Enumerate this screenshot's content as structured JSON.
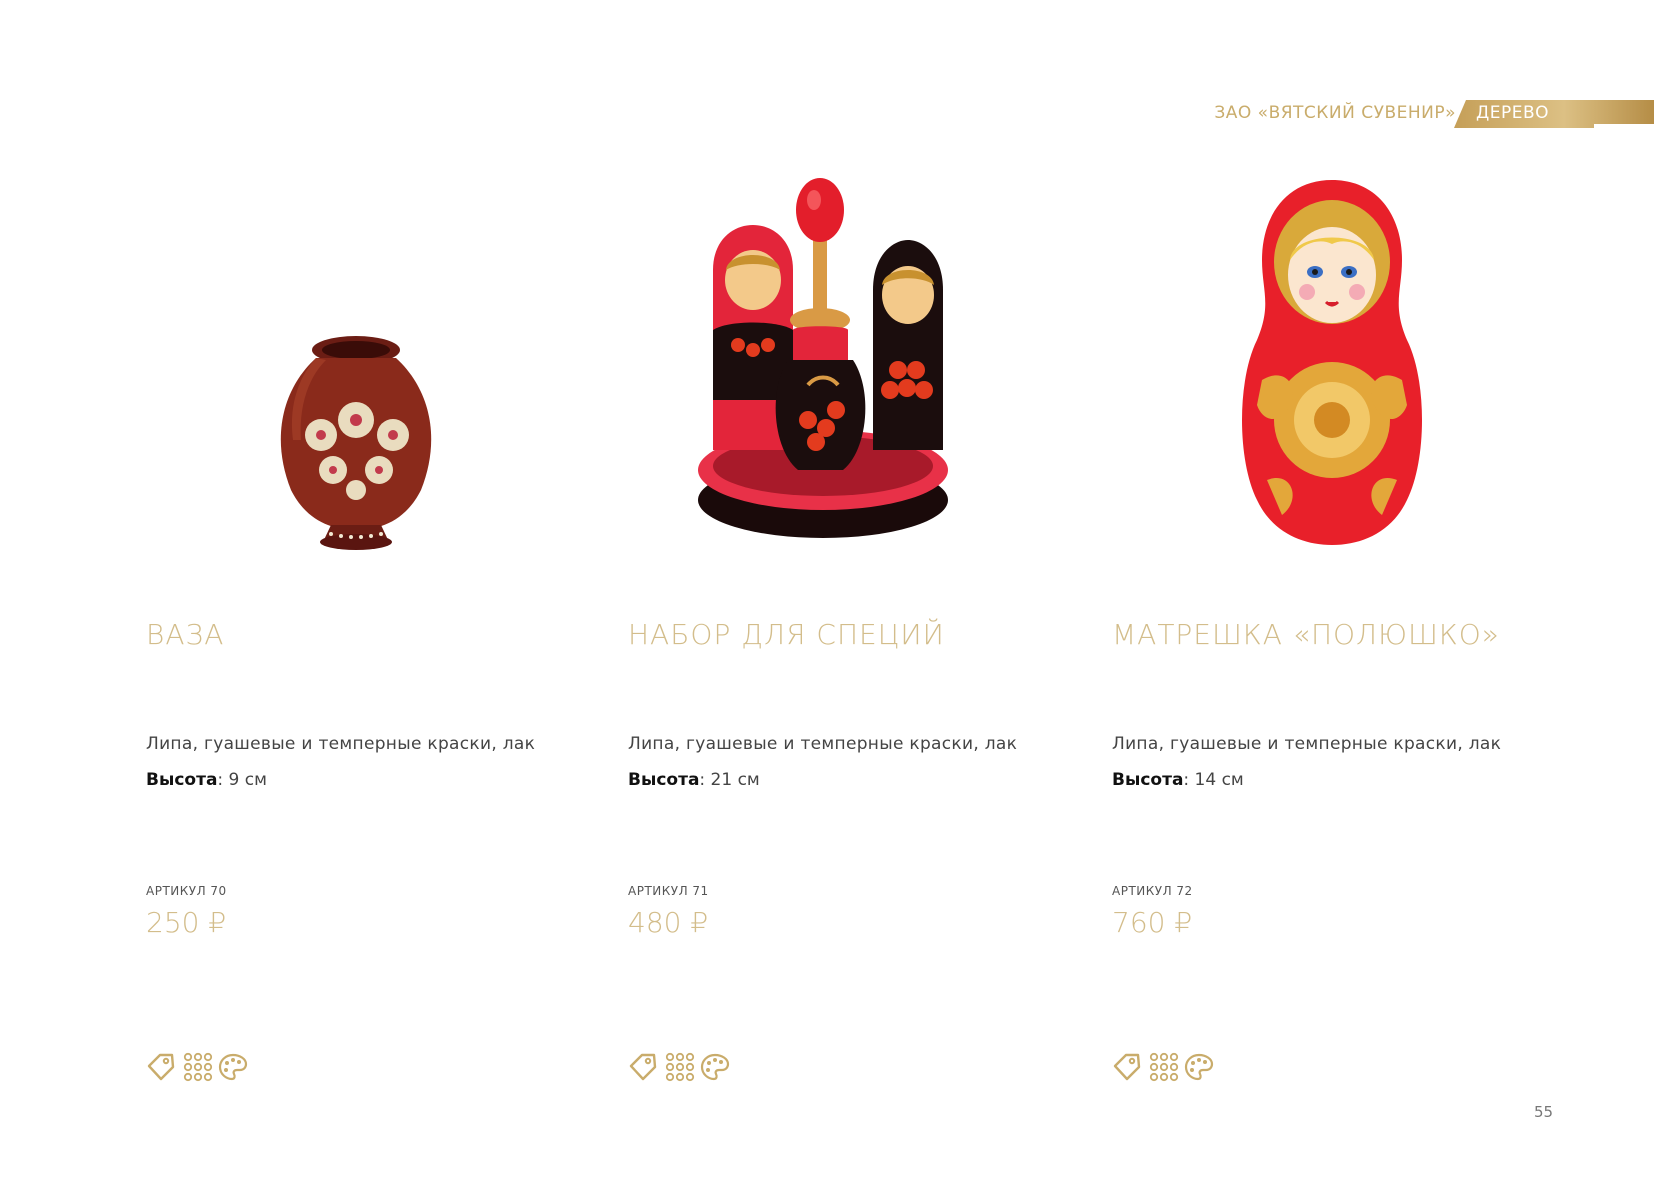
{
  "header": {
    "company": "ЗАО «ВЯТСКИЙ СУВЕНИР»",
    "category": "ДЕРЕВО"
  },
  "products": [
    {
      "title": "ВАЗА",
      "material": "Липа, гуашевые и темперные краски, лак",
      "height_label": "Высота",
      "height_value": ": 9 см",
      "sku": "АРТИКУЛ 70",
      "price": "250 ₽"
    },
    {
      "title": "НАБОР ДЛЯ СПЕЦИЙ",
      "material": "Липа, гуашевые и темперные краски, лак",
      "height_label": "Высота",
      "height_value": ": 21 см",
      "sku": "АРТИКУЛ 71",
      "price": "480 ₽"
    },
    {
      "title": "МАТРЕШКА «ПОЛЮШКО»",
      "material": "Липа, гуашевые и темперные краски, лак",
      "height_label": "Высота",
      "height_value": ": 14 см",
      "sku": "АРТИКУЛ 72",
      "price": "760 ₽"
    }
  ],
  "icons": [
    "tag-icon",
    "grid-icon",
    "palette-icon"
  ],
  "colors": {
    "gold": "#d3bd8b",
    "gold_dark": "#c59f58",
    "text": "#444444"
  },
  "page_number": "55"
}
